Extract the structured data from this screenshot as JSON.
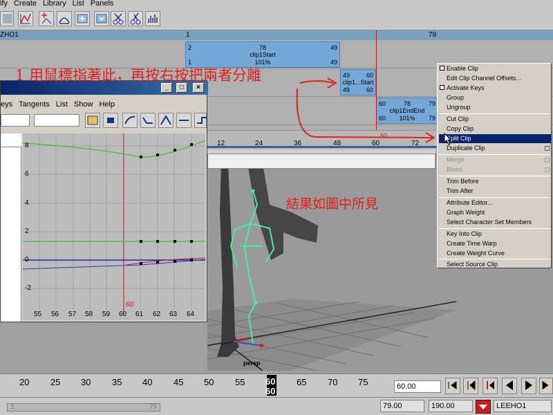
{
  "menubar": {
    "items": [
      "ify",
      "Create",
      "Library",
      "List",
      "Panels"
    ]
  },
  "trax": {
    "header_label": "ZHO1",
    "header_start": "1",
    "header_end": "79",
    "clip1": {
      "tl": "2",
      "tr": "49",
      "name": "clip1Start",
      "bl": "1",
      "br": "49",
      "pct": "101%"
    },
    "clip2": {
      "tl": "49",
      "tr": "60",
      "name": "clip1...Start",
      "bl": "49",
      "br": "60"
    },
    "clip3": {
      "tl": "60",
      "tm": "78",
      "tr": "79",
      "name": "clip1EndEnd",
      "bl": "60",
      "pct": "101%",
      "br": "79"
    },
    "ruler_ticks": [
      "12",
      "24",
      "36",
      "48",
      "60",
      "72"
    ],
    "ruler_current": "60"
  },
  "graph_editor": {
    "menu": [
      "eys",
      "Tangents",
      "List",
      "Show",
      "Help"
    ],
    "close_glyph": "×",
    "y_ticks": [
      "8",
      "6",
      "4",
      "2",
      "0",
      "-2"
    ],
    "x_ticks": [
      "55",
      "56",
      "57",
      "58",
      "59",
      "60",
      "61",
      "62",
      "63",
      "64"
    ],
    "current_frame": "60"
  },
  "context_menu": {
    "items": [
      {
        "label": "Enable Clip",
        "check": true
      },
      {
        "label": "Edit Clip Channel Offsets..."
      },
      {
        "label": "Activate Keys",
        "check": true
      },
      {
        "label": "Group"
      },
      {
        "label": "Ungroup"
      },
      {
        "label": "Cut Clip"
      },
      {
        "label": "Copy Clip"
      },
      {
        "label": "Split Clip",
        "selected": true
      },
      {
        "label": "Duplicate Clip",
        "option": true
      },
      {
        "label": "Merge",
        "disabled": true,
        "option": true
      },
      {
        "label": "Blend",
        "disabled": true,
        "option": true
      },
      {
        "label": "Trim Before"
      },
      {
        "label": "Trim After"
      },
      {
        "label": "Attribute Editor..."
      },
      {
        "label": "Graph Weight"
      },
      {
        "label": "Select Character Set Members"
      },
      {
        "label": "Key Into Clip"
      },
      {
        "label": "Create Time Warp"
      },
      {
        "label": "Create Weight Curve"
      },
      {
        "label": "Select Source Clip"
      }
    ]
  },
  "annotations": {
    "step1": "1 用鼠標指著此，再按右按把兩者分離",
    "result": "結果如圖中所見"
  },
  "viewport": {
    "camera_label": "persp"
  },
  "timeslider": {
    "ticks": [
      "20",
      "25",
      "30",
      "35",
      "40",
      "45",
      "50",
      "55",
      "60",
      "65",
      "70",
      "75"
    ],
    "current_top": "60",
    "current_bottom": "60",
    "current_field": "60.00"
  },
  "rangebar": {
    "slider_start": "1",
    "slider_end": "79",
    "end_field": "79.00",
    "max_field": "190.00",
    "character_set": "LEEHO1"
  },
  "colors": {
    "clip": "#74a8d8",
    "selection": "#0a246a",
    "annotation": "#e02020"
  }
}
